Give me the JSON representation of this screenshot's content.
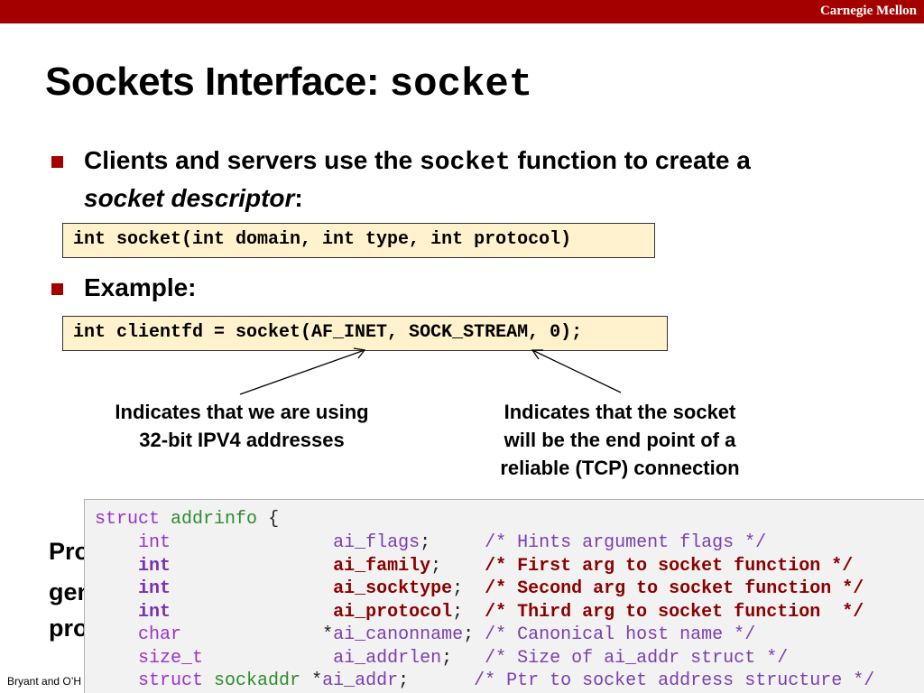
{
  "header": {
    "brand": "Carnegie Mellon"
  },
  "slide": {
    "title_prefix": "Sockets Interface: ",
    "title_code": "socket"
  },
  "bullet1": {
    "line1_pre": "Clients and servers use the ",
    "line1_code": "socket",
    "line1_post": " function to create a",
    "line2_em": "socket descriptor",
    "line2_post": ":"
  },
  "signature": "int socket(int domain, int type, int protocol)",
  "bullet2": {
    "label": "Example:"
  },
  "example": "int clientfd = socket(AF_INET, SOCK_STREAM, 0);",
  "notes": {
    "left": [
      "Indicates that we are using",
      "32-bit IPV4 addresses"
    ],
    "right": [
      "Indicates that the socket",
      "will be the end point of a",
      "reliable (TCP) connection"
    ]
  },
  "partial_text": [
    "Pro",
    "gen",
    "pro"
  ],
  "footer": "Bryant and O’H",
  "struct_code": {
    "open": [
      "struct",
      "addrinfo",
      "{"
    ],
    "fields": [
      {
        "type": "int",
        "pad": "              ",
        "ptr": " ",
        "name": "ai_flags",
        "semi": ";",
        "gap": "     ",
        "comment": "/* Hints argument flags */",
        "highlight": false
      },
      {
        "type": "int",
        "pad": "              ",
        "ptr": " ",
        "name": "ai_family",
        "semi": ";",
        "gap": "    ",
        "comment": "/* First arg to socket function */",
        "highlight": true
      },
      {
        "type": "int",
        "pad": "              ",
        "ptr": " ",
        "name": "ai_socktype",
        "semi": ";",
        "gap": "  ",
        "comment": "/* Second arg to socket function */",
        "highlight": true
      },
      {
        "type": "int",
        "pad": "              ",
        "ptr": " ",
        "name": "ai_protocol",
        "semi": ";",
        "gap": "  ",
        "comment": "/* Third arg to socket function  */",
        "highlight": true
      },
      {
        "type": "char",
        "pad": "             ",
        "ptr": "*",
        "name": "ai_canonname",
        "semi": ";",
        "gap": " ",
        "comment": "/* Canonical host name */",
        "highlight": false
      },
      {
        "type": "size_t",
        "pad": "           ",
        "ptr": " ",
        "name": "ai_addrlen",
        "semi": ";",
        "gap": "   ",
        "comment": "/* Size of ai_addr struct */",
        "highlight": false
      },
      {
        "type": "struct sockaddr",
        "pad": " ",
        "ptr": "*",
        "name": "ai_addr",
        "semi": ";",
        "gap": "      ",
        "comment": "/* Ptr to socket address structure */",
        "highlight": false
      }
    ]
  },
  "colors": {
    "brand_bar": "#a50000",
    "code_box_bg": "#fff2cc",
    "struct_bg": "#f2f2f2",
    "keyword": "#9933cc",
    "type_name": "#2e8b2e",
    "highlight": "#8b0000"
  }
}
